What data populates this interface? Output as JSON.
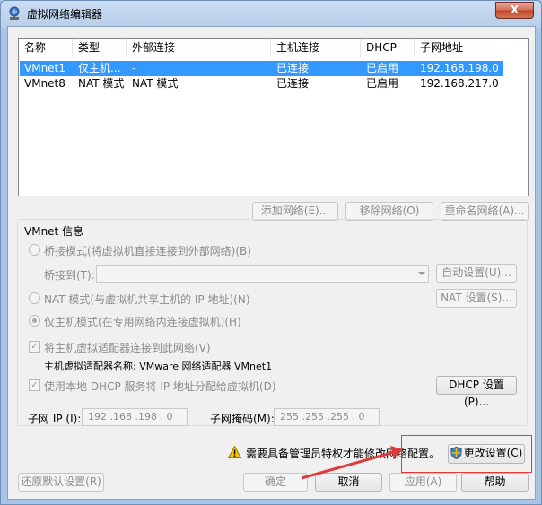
{
  "window": {
    "title": "虚拟网络编辑器",
    "close_label": "X"
  },
  "table": {
    "columns": [
      "名称",
      "类型",
      "外部连接",
      "主机连接",
      "DHCP",
      "子网地址"
    ],
    "rows": [
      {
        "name": "VMnet1",
        "type": "仅主机...",
        "external": "-",
        "host": "已连接",
        "dhcp": "已启用",
        "subnet": "192.168.198.0",
        "selected": true
      },
      {
        "name": "VMnet8",
        "type": "NAT 模式",
        "external": "NAT 模式",
        "host": "已连接",
        "dhcp": "已启用",
        "subnet": "192.168.217.0",
        "selected": false
      }
    ]
  },
  "list_buttons": {
    "add": "添加网络(E)...",
    "remove": "移除网络(O)",
    "rename": "重命名网络(A)..."
  },
  "vmnet_info": {
    "title": "VMnet 信息",
    "bridged_label": "桥接模式(将虚拟机直接连接到外部网络)(B)",
    "bridged_to_label": "桥接到(T):",
    "bridged_to_value": "",
    "auto_settings": "自动设置(U)...",
    "nat_label": "NAT 模式(与虚拟机共享主机的 IP 地址)(N)",
    "nat_settings": "NAT 设置(S)...",
    "hostonly_label": "仅主机模式(在专用网络内连接虚拟机)(H)",
    "connect_adapter_label": "将主机虚拟适配器连接到此网络(V)",
    "adapter_name_label": "主机虚拟适配器名称: VMware 网络适配器 VMnet1",
    "dhcp_label": "使用本地 DHCP 服务将 IP 地址分配给虚拟机(D)",
    "dhcp_settings": "DHCP 设置(P)...",
    "subnet_ip_label": "子网 IP (I):",
    "subnet_ip_value": "192 .168 .198 . 0",
    "subnet_mask_label": "子网掩码(M):",
    "subnet_mask_value": "255 .255 .255 . 0"
  },
  "admin": {
    "warning": "需要具备管理员特权才能修改网络配置。",
    "change_settings": "更改设置(C)"
  },
  "footer": {
    "restore": "还原默认设置(R)",
    "ok": "确定",
    "cancel": "取消",
    "apply": "应用(A)",
    "help": "帮助"
  },
  "colors": {
    "selection": "#3399ff",
    "highlight_box": "#e03a3a"
  }
}
